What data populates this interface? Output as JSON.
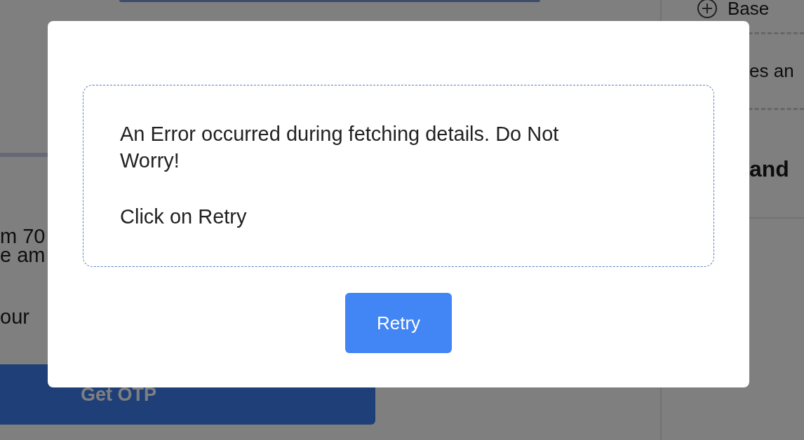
{
  "background": {
    "text_lines": [
      "m 70",
      "e am",
      "our"
    ],
    "otp_button": "Get OTP",
    "sidebar": {
      "items": [
        {
          "label": "Base",
          "kind": "expandable"
        },
        {
          "label": "es an",
          "kind": "plain"
        }
      ],
      "heading": "and"
    }
  },
  "dialog": {
    "message": "An Error occurred during fetching details. Do Not Worry!",
    "instruction": "Click on Retry",
    "button": "Retry"
  }
}
